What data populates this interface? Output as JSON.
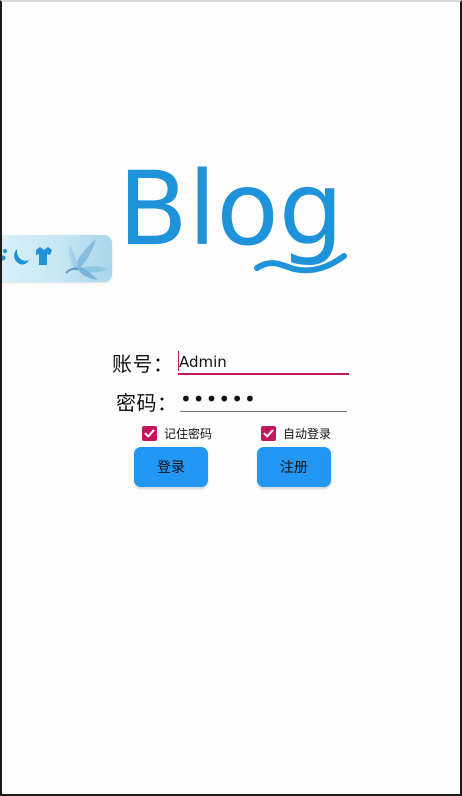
{
  "logo": {
    "text": "Blog"
  },
  "login_form": {
    "account_label": "账号：",
    "account_value": "Admin",
    "password_label": "密码：",
    "password_value": "••••••",
    "remember_password_label": "记住密码",
    "remember_password_checked": true,
    "auto_login_label": "自动登录",
    "auto_login_checked": true,
    "login_button": "登录",
    "register_button": "注册"
  },
  "floating_tab": {
    "icons": [
      "moon-icon",
      "shirt-icon",
      "flower-icon"
    ]
  },
  "colors": {
    "brand_blue": "#1f93d9",
    "button_blue": "#2196f3",
    "accent_pink": "#c2185b"
  }
}
